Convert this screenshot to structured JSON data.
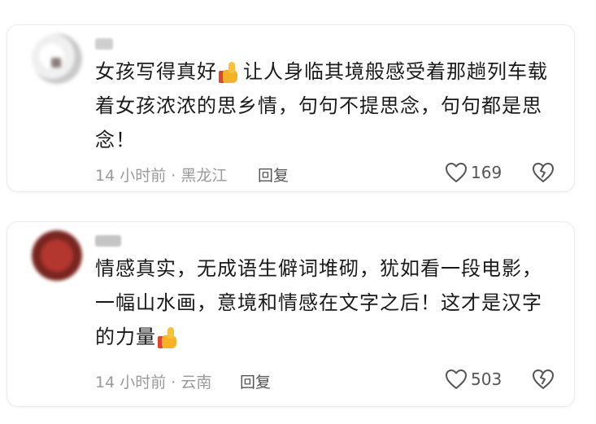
{
  "comments": [
    {
      "username": "",
      "text_part1": "女孩写得真好",
      "text_part2": "让人身临其境般感受着那趟列车载着女孩浓浓的思乡情，句句不提思念，句句都是思念！",
      "time_location": "14 小时前 · 黑龙江",
      "reply_label": "回复",
      "like_count": "169",
      "emoji": "thumbs-up-icon"
    },
    {
      "username": "",
      "text_part1": "情感真实，无成语生僻词堆砌，犹如看一段电影，一幅山水画，意境和情感在文字之后！这才是汉字的力量",
      "text_part2": "",
      "time_location": "14 小时前 · 云南",
      "reply_label": "回复",
      "like_count": "503",
      "emoji": "thumbs-up-icon"
    }
  ],
  "colors": {
    "text": "#1a1a1a",
    "meta": "#9a9a9a",
    "action": "#555555",
    "thumb": "#f5b226"
  }
}
